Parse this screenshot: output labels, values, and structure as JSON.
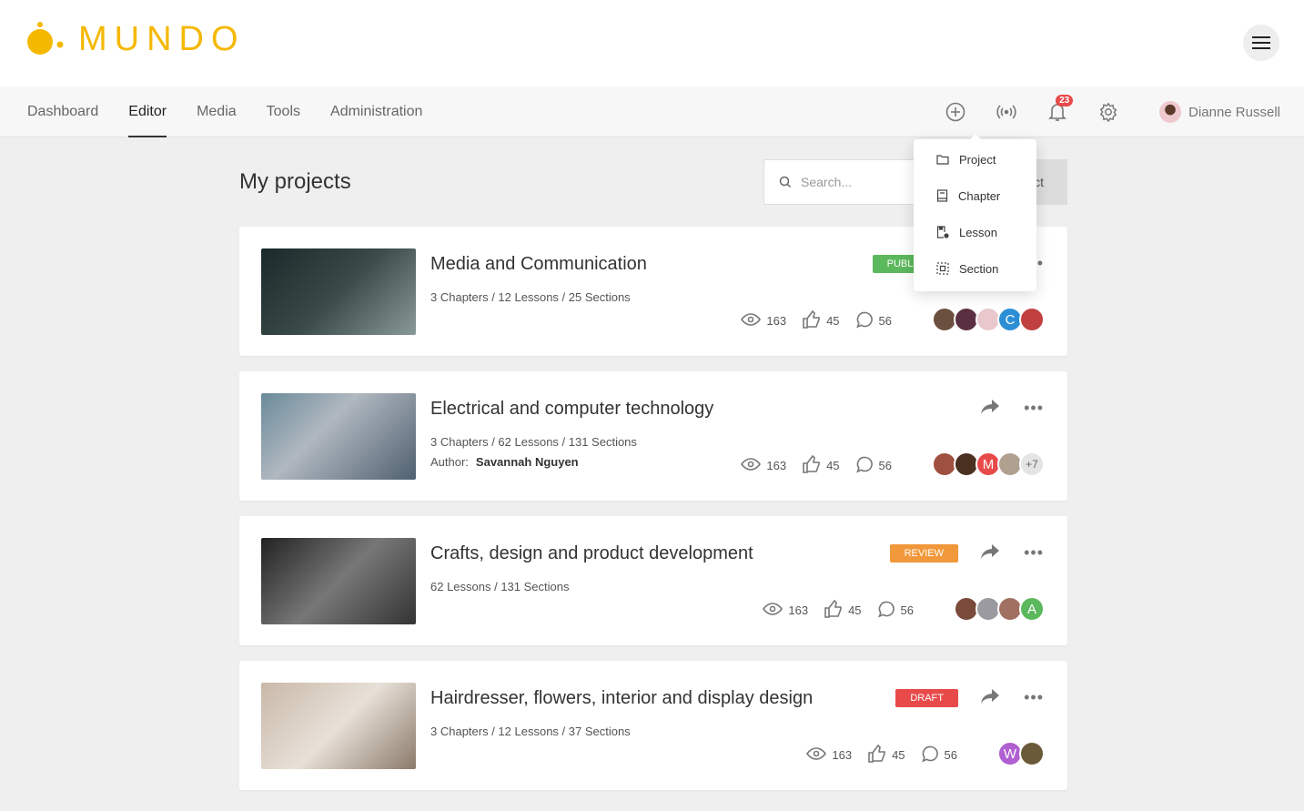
{
  "brand": {
    "name": "MUNDO",
    "color": "#f5b800"
  },
  "nav": {
    "items": [
      {
        "label": "Dashboard"
      },
      {
        "label": "Editor",
        "active": true
      },
      {
        "label": "Media"
      },
      {
        "label": "Tools"
      },
      {
        "label": "Administration"
      }
    ],
    "notifications": "23",
    "user": "Dianne Russell"
  },
  "page": {
    "title": "My projects",
    "search_placeholder": "Search...",
    "new_button": "New project"
  },
  "menu": {
    "items": [
      {
        "label": "Project",
        "icon": "folder-icon"
      },
      {
        "label": "Chapter",
        "icon": "book-icon"
      },
      {
        "label": "Lesson",
        "icon": "lesson-icon"
      },
      {
        "label": "Section",
        "icon": "section-icon"
      }
    ]
  },
  "projects": [
    {
      "title": "Media and Communication",
      "meta": "3 Chapters / 12 Lessons / 25 Sections",
      "status": "PUBLISHED",
      "status_color": "#5cb85c",
      "views": "163",
      "likes": "45",
      "comments": "56",
      "avatars": [
        {
          "c": "#6b5040"
        },
        {
          "c": "#5a3040"
        },
        {
          "c": "#e8c8cc"
        },
        {
          "l": "C",
          "c": "#2c8fd6"
        },
        {
          "c": "#c04040"
        }
      ]
    },
    {
      "title": "Electrical and computer technology",
      "meta": "3 Chapters / 62 Lessons / 131 Sections",
      "author_label": "Author:",
      "author": "Savannah Nguyen",
      "views": "163",
      "likes": "45",
      "comments": "56",
      "avatars": [
        {
          "c": "#a05040"
        },
        {
          "c": "#4a3020"
        },
        {
          "l": "M",
          "c": "#e84a4a"
        },
        {
          "c": "#b0a090"
        }
      ],
      "extra": "+7"
    },
    {
      "title": "Crafts, design and product development",
      "meta": "62 Lessons / 131 Sections",
      "status": "REVIEW",
      "status_color": "#f0983a",
      "views": "163",
      "likes": "45",
      "comments": "56",
      "avatars": [
        {
          "c": "#7a4a3a"
        },
        {
          "c": "#9a9aa0"
        },
        {
          "c": "#a07060"
        },
        {
          "l": "A",
          "c": "#5cb85c"
        }
      ]
    },
    {
      "title": "Hairdresser, flowers, interior and display design",
      "meta": "3 Chapters / 12 Lessons / 37 Sections",
      "status": "DRAFT",
      "status_color": "#e84a4a",
      "views": "163",
      "likes": "45",
      "comments": "56",
      "avatars": [
        {
          "l": "W",
          "c": "#b060d0"
        },
        {
          "c": "#6a5a3a"
        }
      ]
    }
  ]
}
